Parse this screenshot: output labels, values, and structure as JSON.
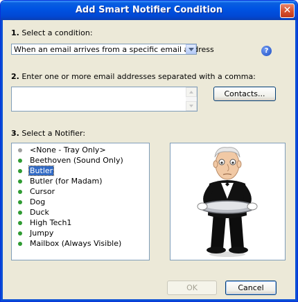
{
  "window": {
    "title": "Add Smart Notifier Condition",
    "close_glyph": "✕"
  },
  "step1": {
    "number": "1.",
    "label": "Select a condition:",
    "selected": "When an email arrives from a specific email address"
  },
  "help": {
    "glyph": "?"
  },
  "step2": {
    "number": "2.",
    "label": "Enter one or more email addresses separated with a comma:",
    "value": ""
  },
  "contacts_button": "Contacts...",
  "step3": {
    "number": "3.",
    "label": "Select a Notifier:"
  },
  "notifiers": [
    {
      "label": "<None - Tray Only>",
      "bullet": "grey"
    },
    {
      "label": "Beethoven (Sound Only)",
      "bullet": "green"
    },
    {
      "label": "Butler",
      "bullet": "green",
      "selected": true
    },
    {
      "label": "Butler (for Madam)",
      "bullet": "green"
    },
    {
      "label": "Cursor",
      "bullet": "green"
    },
    {
      "label": "Dog",
      "bullet": "green"
    },
    {
      "label": "Duck",
      "bullet": "green"
    },
    {
      "label": "High Tech1",
      "bullet": "green"
    },
    {
      "label": "Jumpy",
      "bullet": "green"
    },
    {
      "label": "Mailbox (Always Visible)",
      "bullet": "green"
    }
  ],
  "buttons": {
    "ok": "OK",
    "cancel": "Cancel"
  },
  "colors": {
    "titlebar": "#0054e3",
    "selection": "#316ac5",
    "bullet_green": "#2f9b32"
  }
}
